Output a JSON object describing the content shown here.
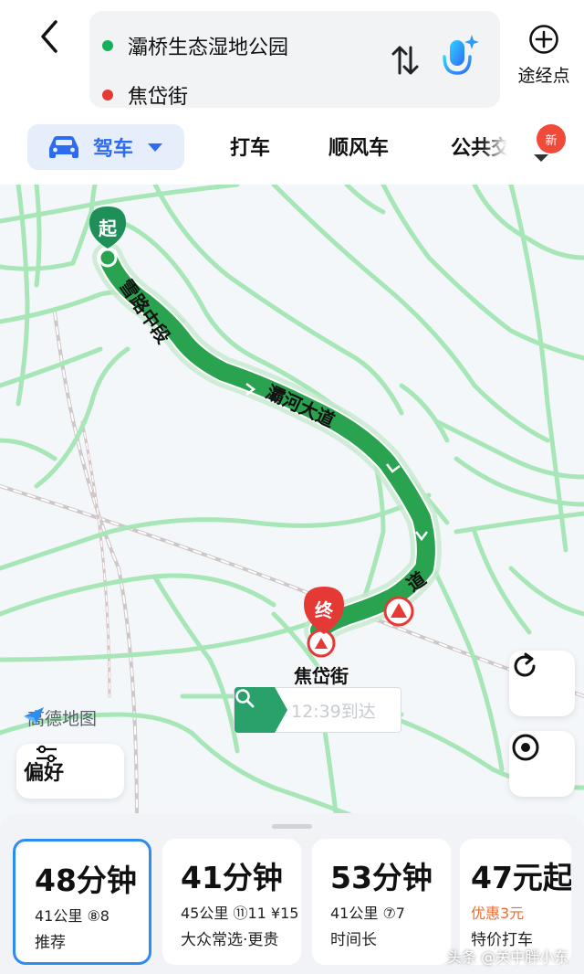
{
  "header": {
    "origin": "灞桥生态湿地公园",
    "destination": "焦岱街",
    "waypoint_label": "途经点",
    "colors": {
      "origin_dot": "#16b05a",
      "destination_dot": "#e53935"
    }
  },
  "tabs": {
    "drive": "驾车",
    "taxi": "打车",
    "carpool": "顺风车",
    "transit": "公共交",
    "new_badge": "新",
    "active": "驾车"
  },
  "map": {
    "start_marker": "起",
    "end_marker": "终",
    "destination_label": "焦岱街",
    "road_labels": {
      "road_1": "雪路中段",
      "road_2": "灞河大道",
      "road_3": "道"
    },
    "brand": "高德地图",
    "search_eta": "12:39到达",
    "preference_label": "偏好",
    "route_color": "#2aa350"
  },
  "routes": [
    {
      "time": "48分钟",
      "meta": "41公里 ⑧8",
      "tag": "推荐",
      "selected": true
    },
    {
      "time": "41分钟",
      "meta": "45公里 ⑪11 ¥15",
      "tag": "大众常选·更贵",
      "selected": false
    },
    {
      "time": "53分钟",
      "meta": "41公里 ⑦7",
      "tag": "时间长",
      "selected": false
    },
    {
      "time": "47元起",
      "meta": "优惠3元",
      "tag": "特价打车",
      "selected": false
    }
  ],
  "watermark": "头条 @关中胖小东"
}
